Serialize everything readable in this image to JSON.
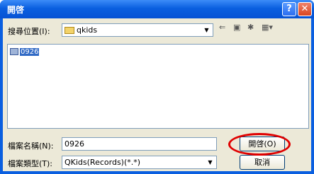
{
  "window": {
    "title": "開啓"
  },
  "titlebar": {
    "help_label": "?",
    "close_label": "✕"
  },
  "lookin": {
    "label": "搜尋位置(I):",
    "value": "qkids"
  },
  "files": [
    {
      "name": "0926"
    }
  ],
  "filename_field": {
    "label": "檔案名稱(N):",
    "value": "0926"
  },
  "filetype_field": {
    "label": "檔案類型(T):",
    "value": "QKids(Records)(*.*)"
  },
  "buttons": {
    "open": "開啓(O)",
    "cancel": "取消"
  },
  "icons": [
    "folder-icon",
    "back-icon",
    "up-folder-icon",
    "new-folder-icon",
    "view-menu-icon",
    "chevron-down-icon"
  ],
  "accent": "#0a5fe0",
  "highlight_color": "#e00000"
}
